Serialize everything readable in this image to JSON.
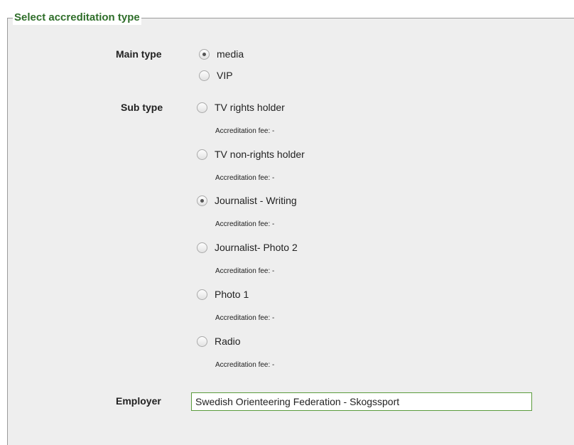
{
  "legend": "Select accreditation type",
  "main_type": {
    "label": "Main type",
    "options": [
      {
        "label": "media",
        "checked": true
      },
      {
        "label": "VIP",
        "checked": false
      }
    ]
  },
  "sub_type": {
    "label": "Sub type",
    "options": [
      {
        "label": "TV rights holder",
        "checked": false,
        "fee": "Accreditation fee: -"
      },
      {
        "label": "TV non-rights holder",
        "checked": false,
        "fee": "Accreditation fee: -"
      },
      {
        "label": "Journalist - Writing",
        "checked": true,
        "fee": "Accreditation fee: -"
      },
      {
        "label": "Journalist- Photo 2",
        "checked": false,
        "fee": "Accreditation fee: -"
      },
      {
        "label": "Photo 1",
        "checked": false,
        "fee": "Accreditation fee: -"
      },
      {
        "label": "Radio",
        "checked": false,
        "fee": "Accreditation fee: -"
      }
    ]
  },
  "employer": {
    "label": "Employer",
    "value": "Swedish Orienteering Federation - Skogssport"
  }
}
